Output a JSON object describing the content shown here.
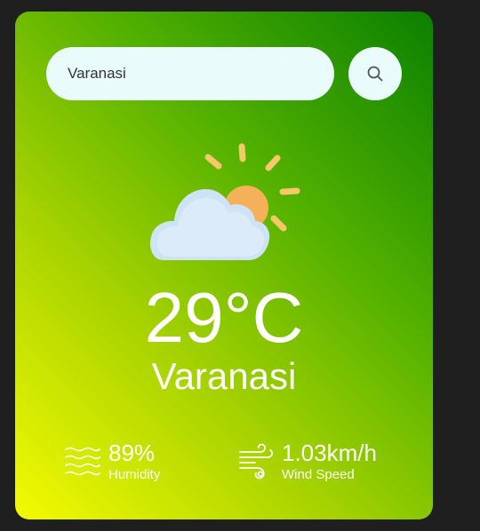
{
  "search": {
    "value": "Varanasi"
  },
  "weather": {
    "icon": "partly-cloudy-icon",
    "temperature": "29°C",
    "city": "Varanasi"
  },
  "details": {
    "humidity": {
      "icon": "humidity-waves-icon",
      "value": "89%",
      "label": "Humidity"
    },
    "wind": {
      "icon": "wind-icon",
      "value": "1.03km/h",
      "label": "Wind Speed"
    }
  },
  "colors": {
    "gradient_top_right": "#0a8000",
    "gradient_bottom_left": "#f4fb00",
    "input_background": "#e9fbfb",
    "page_background": "#1f1f1f"
  }
}
